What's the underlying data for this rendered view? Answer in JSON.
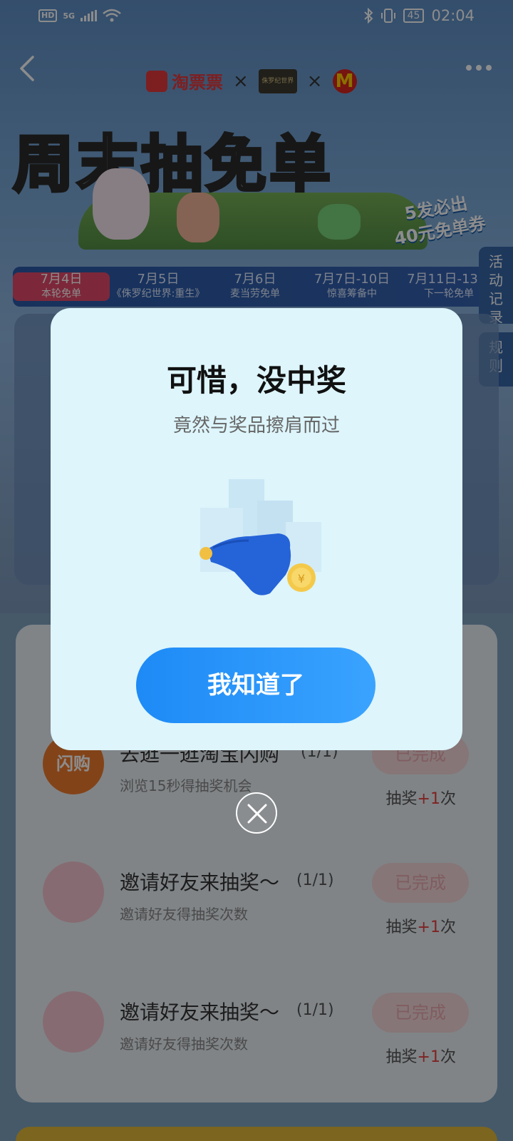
{
  "status_bar": {
    "hd": "HD",
    "network": "5G",
    "battery": "45",
    "time": "02:04"
  },
  "brands": {
    "taopiaopiao": "淘票票",
    "jurassic": "侏罗纪世界",
    "x1": "×",
    "x2": "×",
    "mcdonalds": "M"
  },
  "banner": {
    "title": "周末抽免单",
    "badge_line1": "5发必出",
    "badge_line2": "40元免单券"
  },
  "date_strip": [
    {
      "date": "7月4日",
      "label": "本轮免单"
    },
    {
      "date": "7月5日",
      "label": "《侏罗纪世界:重生》"
    },
    {
      "date": "7月6日",
      "label": "麦当劳免单"
    },
    {
      "date": "7月7日-10日",
      "label": "惊喜筹备中"
    },
    {
      "date": "7月11日-13日",
      "label": "下一轮免单"
    }
  ],
  "side_tabs": {
    "records": "活动记录",
    "rules": "规则"
  },
  "tasks": [
    {
      "title": "去逛一逛淘宝闪购",
      "progress": "(1/1)",
      "sub": "浏览15秒得抽奖机会",
      "status": "已完成",
      "reward_prefix": "抽奖",
      "reward_plus": "+1",
      "reward_suffix": "次",
      "icon_text": "闪购"
    },
    {
      "title": "邀请好友来抽奖～",
      "progress": "(1/1)",
      "sub": "邀请好友得抽奖次数",
      "status": "已完成",
      "reward_prefix": "抽奖",
      "reward_plus": "+1",
      "reward_suffix": "次"
    },
    {
      "title": "邀请好友来抽奖～",
      "progress": "(1/1)",
      "sub": "邀请好友得抽奖次数",
      "status": "已完成",
      "reward_prefix": "抽奖",
      "reward_plus": "+1",
      "reward_suffix": "次"
    }
  ],
  "modal": {
    "title": "可惜，没中奖",
    "subtitle": "竟然与奖品擦肩而过",
    "button": "我知道了",
    "coin_symbol": "¥"
  },
  "colors": {
    "accent": "#1d8af6",
    "modal_bg": "#ddf5fb",
    "plus_red": "#e6413f"
  }
}
